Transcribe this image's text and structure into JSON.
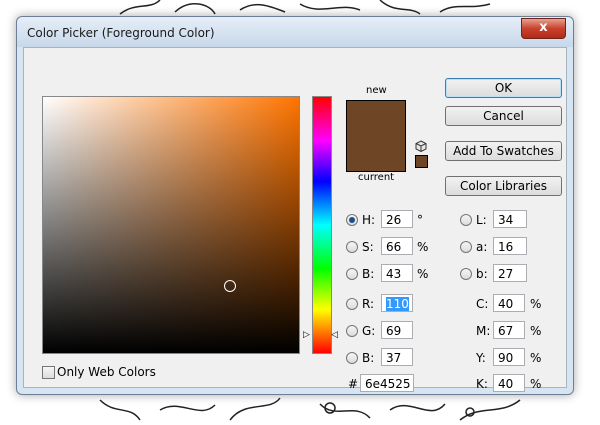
{
  "window": {
    "title": "Color Picker (Foreground Color)",
    "close_glyph": "x"
  },
  "swatch": {
    "new_label": "new",
    "current_label": "current",
    "new_color": "#6e4525",
    "current_color": "#6e4525"
  },
  "buttons": {
    "ok": "OK",
    "cancel": "Cancel",
    "add_to_swatches": "Add To Swatches",
    "color_libraries": "Color Libraries"
  },
  "hsb": {
    "h_label": "H:",
    "h_value": "26",
    "h_unit": "°",
    "s_label": "S:",
    "s_value": "66",
    "s_unit": "%",
    "b_label": "B:",
    "b_value": "43",
    "b_unit": "%"
  },
  "rgb": {
    "r_label": "R:",
    "r_value": "110",
    "g_label": "G:",
    "g_value": "69",
    "b_label": "B:",
    "b_value": "37"
  },
  "lab": {
    "l_label": "L:",
    "l_value": "34",
    "a_label": "a:",
    "a_value": "16",
    "b_label": "b:",
    "b_value": "27"
  },
  "cmyk": {
    "c_label": "C:",
    "c_value": "40",
    "c_unit": "%",
    "m_label": "M:",
    "m_value": "67",
    "m_unit": "%",
    "y_label": "Y:",
    "y_value": "90",
    "y_unit": "%",
    "k_label": "K:",
    "k_value": "40",
    "k_unit": "%"
  },
  "hex": {
    "label": "#",
    "value": "6e4525"
  },
  "only_web_colors": {
    "label": "Only Web Colors",
    "checked": false
  },
  "selected_mode": "H",
  "colors": {
    "field_hue": "#ff7400",
    "accent_select": "#3399ff",
    "dialog_frame": "#d7e4f2"
  }
}
